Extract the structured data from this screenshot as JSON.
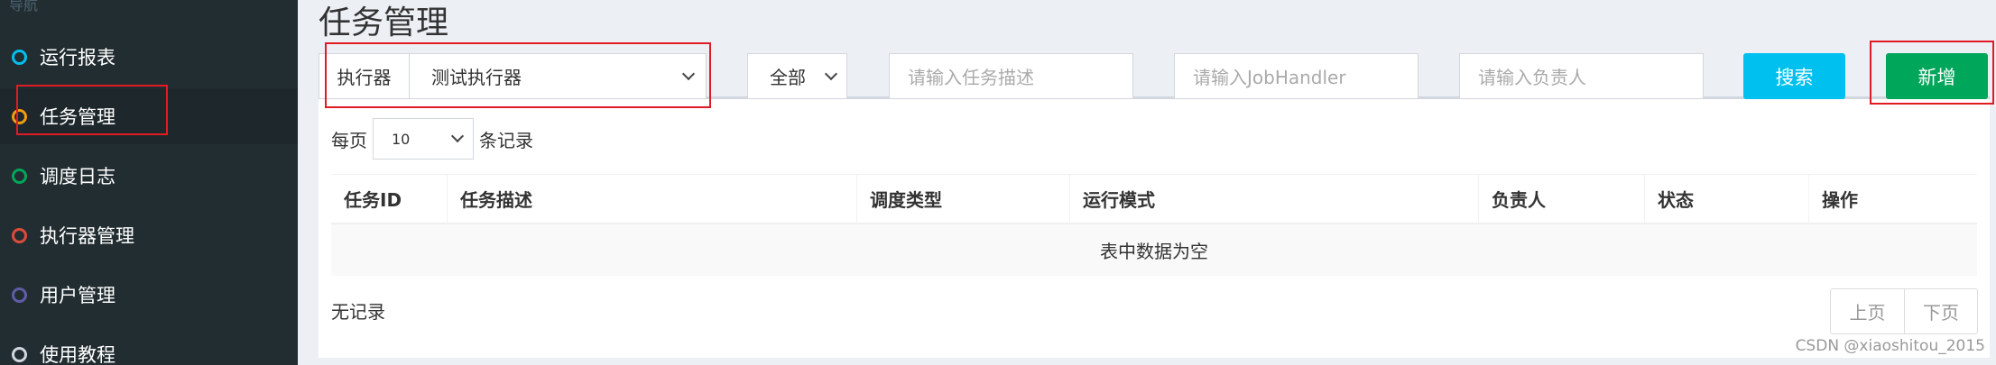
{
  "sidebar": {
    "header": "导航",
    "items": [
      {
        "label": "运行报表",
        "color": "#00c0ef"
      },
      {
        "label": "任务管理",
        "color": "#f39c12"
      },
      {
        "label": "调度日志",
        "color": "#00a65a"
      },
      {
        "label": "执行器管理",
        "color": "#dd4b39"
      },
      {
        "label": "用户管理",
        "color": "#605ca8"
      },
      {
        "label": "使用教程",
        "color": "#d2d6de"
      }
    ],
    "active_index": 1
  },
  "main": {
    "title": "任务管理",
    "filters": {
      "executor_label": "执行器",
      "executor_value": "测试执行器",
      "status_value": "全部",
      "task_desc_placeholder": "请输入任务描述",
      "job_handler_placeholder": "请输入JobHandler",
      "owner_placeholder": "请输入负责人",
      "search_label": "搜索",
      "add_label": "新增"
    },
    "length": {
      "prefix": "每页",
      "value": "10",
      "suffix": "条记录"
    },
    "table": {
      "columns": [
        "任务ID",
        "任务描述",
        "调度类型",
        "运行模式",
        "负责人",
        "状态",
        "操作"
      ],
      "empty_text": "表中数据为空"
    },
    "info_text": "无记录",
    "pagination": {
      "prev_label": "上页",
      "next_label": "下页"
    }
  },
  "watermark": "CSDN @xiaoshitou_2015",
  "colors": {
    "sidebar_bg": "#222d32",
    "search_button": "#00c0ef",
    "add_button": "#00a65a",
    "highlight_box": "#e01b24"
  }
}
